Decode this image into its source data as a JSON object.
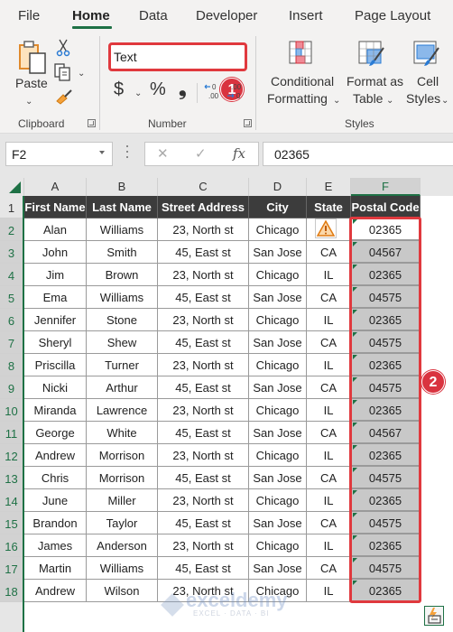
{
  "menu": {
    "tabs": [
      {
        "label": "File"
      },
      {
        "label": "Home",
        "active": true
      },
      {
        "label": "Data"
      },
      {
        "label": "Developer"
      },
      {
        "label": "Insert"
      },
      {
        "label": "Page Layout"
      }
    ]
  },
  "ribbon": {
    "clipboard": {
      "group_label": "Clipboard",
      "paste_label": "Paste",
      "icons": [
        "paste-icon",
        "cut-icon",
        "copy-icon",
        "format-painter-icon"
      ]
    },
    "number": {
      "group_label": "Number",
      "format_value": "Text",
      "currency_symbol": "$",
      "percent_symbol": "%",
      "comma_symbol": "❟",
      "increase_decimal": "←0 .00",
      "decrease_decimal": ".00 →0"
    },
    "styles": {
      "group_label": "Styles",
      "conditional_formatting": [
        "Conditional",
        "Formatting"
      ],
      "format_as_table": [
        "Format as",
        "Table"
      ],
      "cell_styles": [
        "Cell",
        "Styles"
      ]
    }
  },
  "annotations": {
    "badge1": "1",
    "badge2": "2",
    "accent_color": "#e0393e"
  },
  "formula_bar": {
    "name_box": "F2",
    "cancel_symbol": "✕",
    "enter_symbol": "✓",
    "fx_label": "fx",
    "formula": "02365"
  },
  "sheet": {
    "columns": [
      "A",
      "B",
      "C",
      "D",
      "E",
      "F"
    ],
    "selected_column": "F",
    "active_cell": "F2",
    "headers": [
      "First Name",
      "Last Name",
      "Street Address",
      "City",
      "State",
      "Postal Code"
    ],
    "rows": [
      {
        "row": "2",
        "first": "Alan",
        "last": "Williams",
        "street": "23, North st",
        "city": "Chicago",
        "state": "",
        "postal": "02365"
      },
      {
        "row": "3",
        "first": "John",
        "last": "Smith",
        "street": "45, East st",
        "city": "San Jose",
        "state": "CA",
        "postal": "04567"
      },
      {
        "row": "4",
        "first": "Jim",
        "last": "Brown",
        "street": "23, North st",
        "city": "Chicago",
        "state": "IL",
        "postal": "02365"
      },
      {
        "row": "5",
        "first": "Ema",
        "last": "Williams",
        "street": "45, East st",
        "city": "San Jose",
        "state": "CA",
        "postal": "04575"
      },
      {
        "row": "6",
        "first": "Jennifer",
        "last": "Stone",
        "street": "23, North st",
        "city": "Chicago",
        "state": "IL",
        "postal": "02365"
      },
      {
        "row": "7",
        "first": "Sheryl",
        "last": "Shew",
        "street": "45, East st",
        "city": "San Jose",
        "state": "CA",
        "postal": "04575"
      },
      {
        "row": "8",
        "first": "Priscilla",
        "last": "Turner",
        "street": "23, North st",
        "city": "Chicago",
        "state": "IL",
        "postal": "02365"
      },
      {
        "row": "9",
        "first": "Nicki",
        "last": "Arthur",
        "street": "45, East st",
        "city": "San Jose",
        "state": "CA",
        "postal": "04575"
      },
      {
        "row": "10",
        "first": "Miranda",
        "last": "Lawrence",
        "street": "23, North st",
        "city": "Chicago",
        "state": "IL",
        "postal": "02365"
      },
      {
        "row": "11",
        "first": "George",
        "last": "White",
        "street": "45, East st",
        "city": "San Jose",
        "state": "CA",
        "postal": "04567"
      },
      {
        "row": "12",
        "first": "Andrew",
        "last": "Morrison",
        "street": "23, North st",
        "city": "Chicago",
        "state": "IL",
        "postal": "02365"
      },
      {
        "row": "13",
        "first": "Chris",
        "last": "Morrison",
        "street": "45, East st",
        "city": "San Jose",
        "state": "CA",
        "postal": "04575"
      },
      {
        "row": "14",
        "first": "June",
        "last": "Miller",
        "street": "23, North st",
        "city": "Chicago",
        "state": "IL",
        "postal": "02365"
      },
      {
        "row": "15",
        "first": "Brandon",
        "last": "Taylor",
        "street": "45, East st",
        "city": "San Jose",
        "state": "CA",
        "postal": "04575"
      },
      {
        "row": "16",
        "first": "James",
        "last": "Anderson",
        "street": "23, North st",
        "city": "Chicago",
        "state": "IL",
        "postal": "02365"
      },
      {
        "row": "17",
        "first": "Martin",
        "last": "Williams",
        "street": "45, East st",
        "city": "San Jose",
        "state": "CA",
        "postal": "04575"
      },
      {
        "row": "18",
        "first": "Andrew",
        "last": "Wilson",
        "street": "23, North st",
        "city": "Chicago",
        "state": "IL",
        "postal": "02365"
      }
    ]
  },
  "watermark": {
    "name": "exceldemy",
    "tagline": "EXCEL · DATA · BI"
  }
}
